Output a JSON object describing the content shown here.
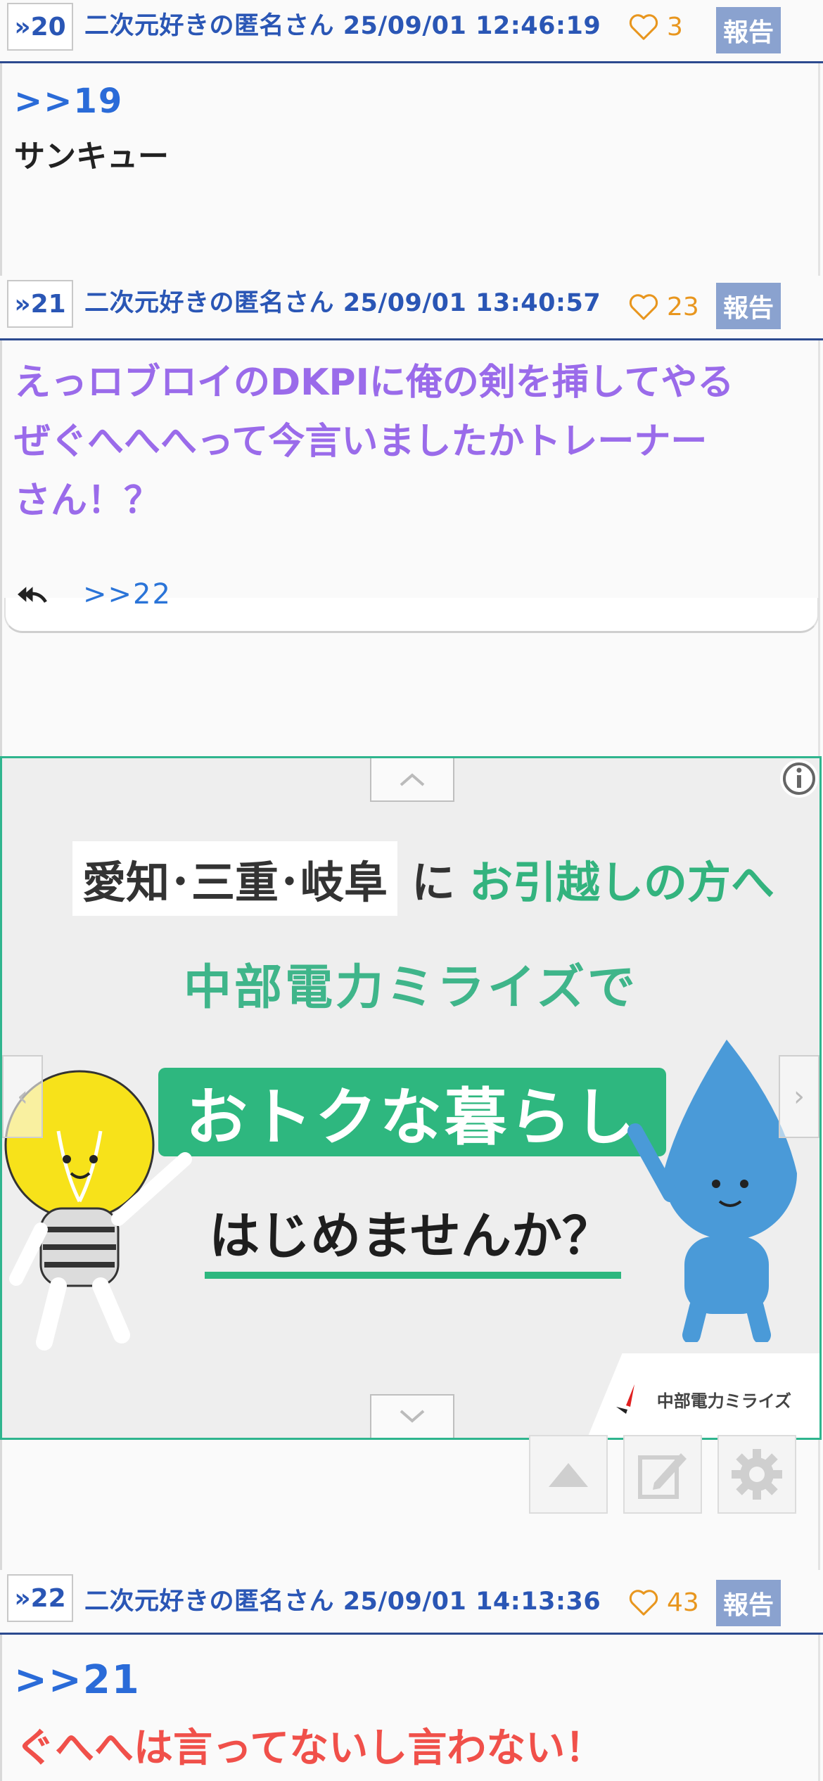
{
  "posts": [
    {
      "num": "»20",
      "name": "二次元好きの匿名さん",
      "datetime": "25/09/01 12:46:19",
      "likes": "3",
      "report": "報告",
      "quote": ">>19",
      "body": "サンキュー"
    },
    {
      "num": "»21",
      "name": "二次元好きの匿名さん",
      "datetime": "25/09/01 13:40:57",
      "likes": "23",
      "report": "報告",
      "body_lines": [
        "えっロブロイのDKPIに俺の剣を挿してやる",
        "ぜぐへへへって今言いましたかトレーナー",
        "さん！？"
      ],
      "reply_link": ">>22"
    },
    {
      "num": "»22",
      "name": "二次元好きの匿名さん",
      "datetime": "25/09/01 14:13:36",
      "likes": "43",
      "report": "報告",
      "quote": ">>21",
      "body": "ぐへへは言ってないし言わない！"
    }
  ],
  "ad": {
    "prefectures": "愛知･三重･岐阜",
    "ni": "に",
    "moving": "お引越しの方へ",
    "brand_line": "中部電力ミライズで",
    "banner": "おトクな暮らし",
    "question": "はじめませんか？",
    "logo_text": "中部電力ミライズ"
  },
  "colors": {
    "header_blue": "#2a56b5",
    "like_orange": "#e8961e",
    "report_bg": "#8aa2cf",
    "purple_text": "#9a6bea",
    "red_text": "#f0504a",
    "ad_green": "#2eb77f"
  },
  "fabs": [
    "up-triangle-icon",
    "edit-icon",
    "gear-icon"
  ]
}
